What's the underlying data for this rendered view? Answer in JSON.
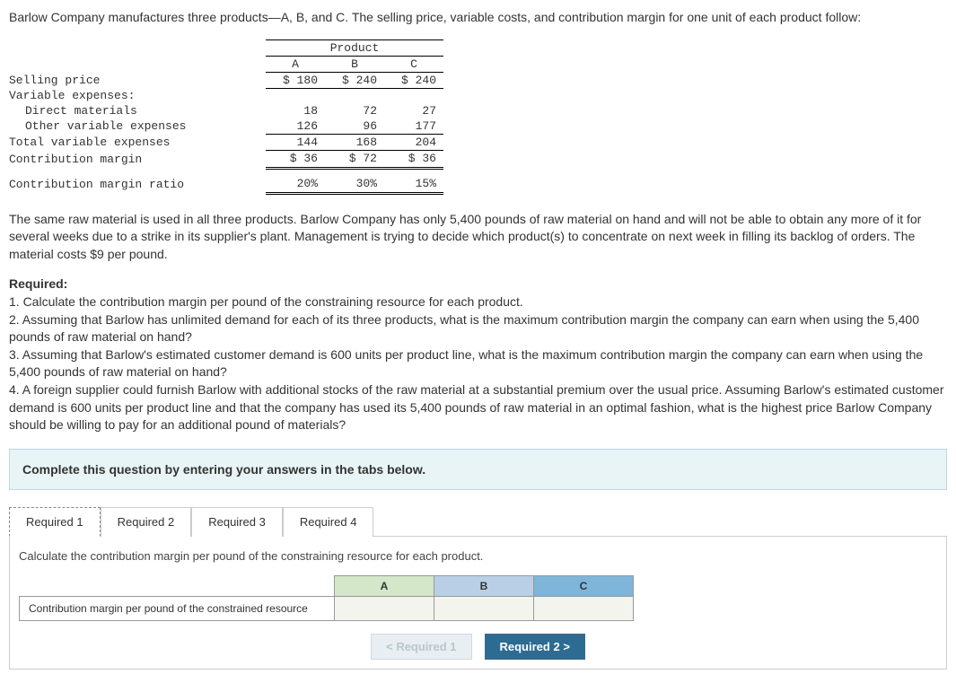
{
  "intro": "Barlow Company manufactures three products—A, B, and C. The selling price, variable costs, and contribution margin for one unit of each product follow:",
  "table": {
    "header_span": "Product",
    "cols": {
      "a": "A",
      "b": "B",
      "c": "C"
    },
    "rows": {
      "selling_price": {
        "label": "Selling price",
        "a": "$ 180",
        "b": "$ 240",
        "c": "$ 240"
      },
      "var_exp_hdr": {
        "label": "Variable expenses:"
      },
      "direct_materials": {
        "label": "Direct materials",
        "a": "18",
        "b": "72",
        "c": "27"
      },
      "other_var": {
        "label": "Other variable expenses",
        "a": "126",
        "b": "96",
        "c": "177"
      },
      "total_var": {
        "label": "Total variable expenses",
        "a": "144",
        "b": "168",
        "c": "204"
      },
      "contrib_margin": {
        "label": "Contribution margin",
        "a": "$ 36",
        "b": "$ 72",
        "c": "$ 36"
      },
      "contrib_ratio": {
        "label": "Contribution margin ratio",
        "a": "20%",
        "b": "30%",
        "c": "15%"
      }
    }
  },
  "narrative": "The same raw material is used in all three products. Barlow Company has only 5,400 pounds of raw material on hand and will not be able to obtain any more of it for several weeks due to a strike in its supplier's plant. Management is trying to decide which product(s) to concentrate on next week in filling its backlog of orders. The material costs $9 per pound.",
  "required": {
    "heading": "Required:",
    "r1": "1. Calculate the contribution margin per pound of the constraining resource for each product.",
    "r2": "2. Assuming that Barlow has unlimited demand for each of its three products, what is the maximum contribution margin the company can earn when using the 5,400 pounds of raw material on hand?",
    "r3": "3. Assuming that Barlow's estimated customer demand is 600 units per product line, what is the maximum contribution margin the company can earn when using the 5,400 pounds of raw material on hand?",
    "r4": "4. A foreign supplier could furnish Barlow with additional stocks of the raw material at a substantial premium over the usual price. Assuming Barlow's estimated customer demand is 600 units per product line and that the company has used its 5,400 pounds of raw material in an optimal fashion, what is the highest price Barlow Company should be willing to pay for an additional pound of materials?"
  },
  "answer_prompt": "Complete this question by entering your answers in the tabs below.",
  "tabs": {
    "t1": "Required 1",
    "t2": "Required 2",
    "t3": "Required 3",
    "t4": "Required 4"
  },
  "tab1": {
    "instruction": "Calculate the contribution margin per pound of the constraining resource for each product.",
    "colA": "A",
    "colB": "B",
    "colC": "C",
    "row_label": "Contribution margin per pound of the constrained resource"
  },
  "nav": {
    "prev": "Required 1",
    "next": "Required 2"
  }
}
